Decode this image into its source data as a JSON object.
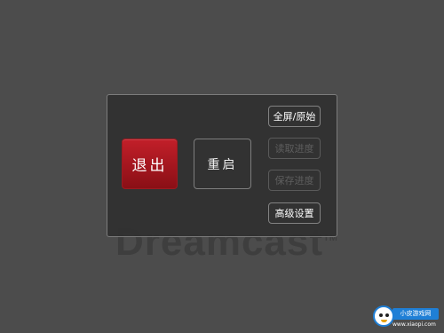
{
  "background": {
    "logo_text": "Dreamcast",
    "logo_tm": "TM"
  },
  "menu": {
    "exit_label": "退出",
    "restart_label": "重启",
    "fullscreen_label": "全屏/原始",
    "load_progress_label": "读取进度",
    "save_progress_label": "保存进度",
    "advanced_settings_label": "高级设置"
  },
  "colors": {
    "background": "#4c4c4c",
    "panel": "#303030",
    "exit_button": "#b01820",
    "disabled_text": "#5e5e5e"
  },
  "watermark": {
    "label": "小皮游戏网",
    "url": "www.xiaopi.com"
  }
}
